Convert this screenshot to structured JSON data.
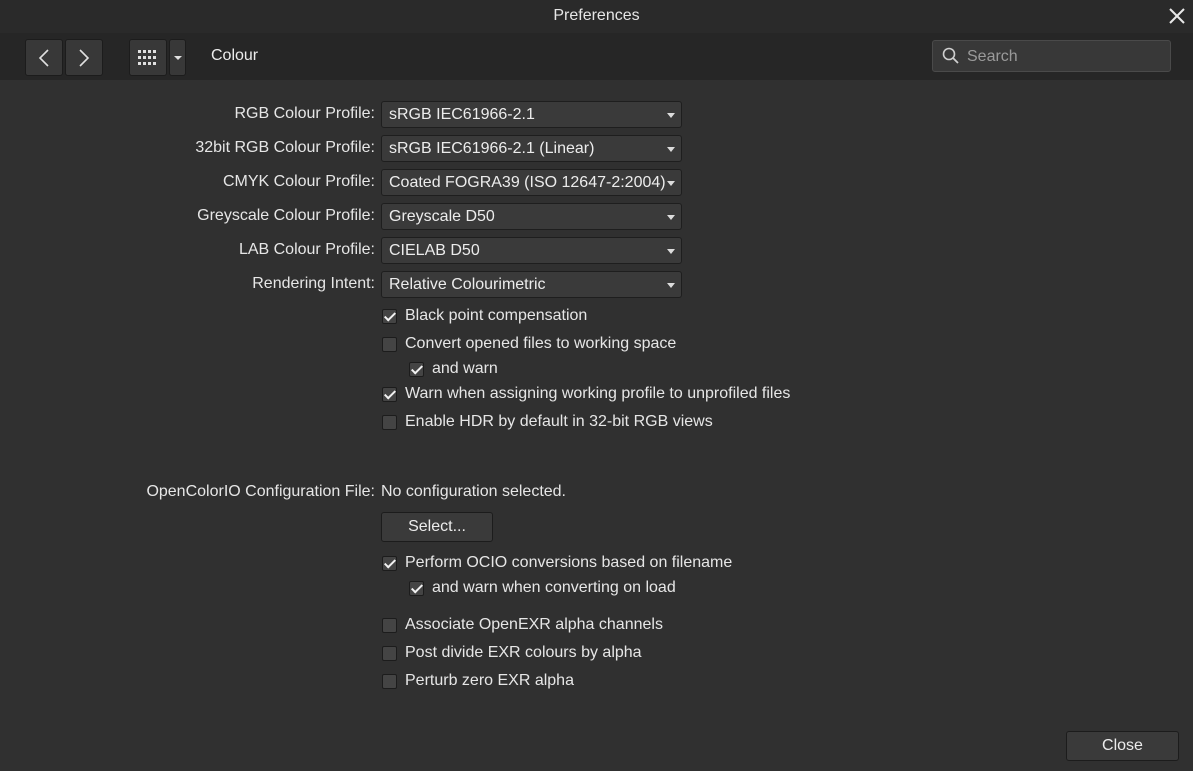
{
  "window": {
    "title": "Preferences"
  },
  "toolbar": {
    "section_title": "Colour",
    "search_placeholder": "Search"
  },
  "profiles": [
    {
      "label": "RGB Colour Profile:",
      "value": "sRGB IEC61966-2.1"
    },
    {
      "label": "32bit RGB Colour Profile:",
      "value": "sRGB IEC61966-2.1 (Linear)"
    },
    {
      "label": "CMYK Colour Profile:",
      "value": "Coated FOGRA39 (ISO 12647-2:2004)"
    },
    {
      "label": "Greyscale Colour Profile:",
      "value": "Greyscale D50"
    },
    {
      "label": "LAB Colour Profile:",
      "value": "CIELAB D50"
    },
    {
      "label": "Rendering Intent:",
      "value": "Relative Colourimetric"
    }
  ],
  "options": [
    {
      "label": "Black point compensation",
      "checked": true
    },
    {
      "label": "Convert opened files to working space",
      "checked": false
    },
    {
      "label": "and warn",
      "checked": true
    },
    {
      "label": "Warn when assigning working profile to unprofiled files",
      "checked": true
    },
    {
      "label": "Enable HDR by default in 32-bit RGB views",
      "checked": false
    }
  ],
  "ocio": {
    "label": "OpenColorIO Configuration File:",
    "value": "No configuration selected.",
    "select_button": "Select...",
    "options": [
      {
        "label": "Perform OCIO conversions based on filename",
        "checked": true
      },
      {
        "label": "and warn when converting on load",
        "checked": true
      }
    ]
  },
  "exr_options": [
    {
      "label": "Associate OpenEXR alpha channels",
      "checked": false
    },
    {
      "label": "Post divide EXR colours by alpha",
      "checked": false
    },
    {
      "label": "Perturb zero EXR alpha",
      "checked": false
    }
  ],
  "footer": {
    "close_button": "Close"
  }
}
